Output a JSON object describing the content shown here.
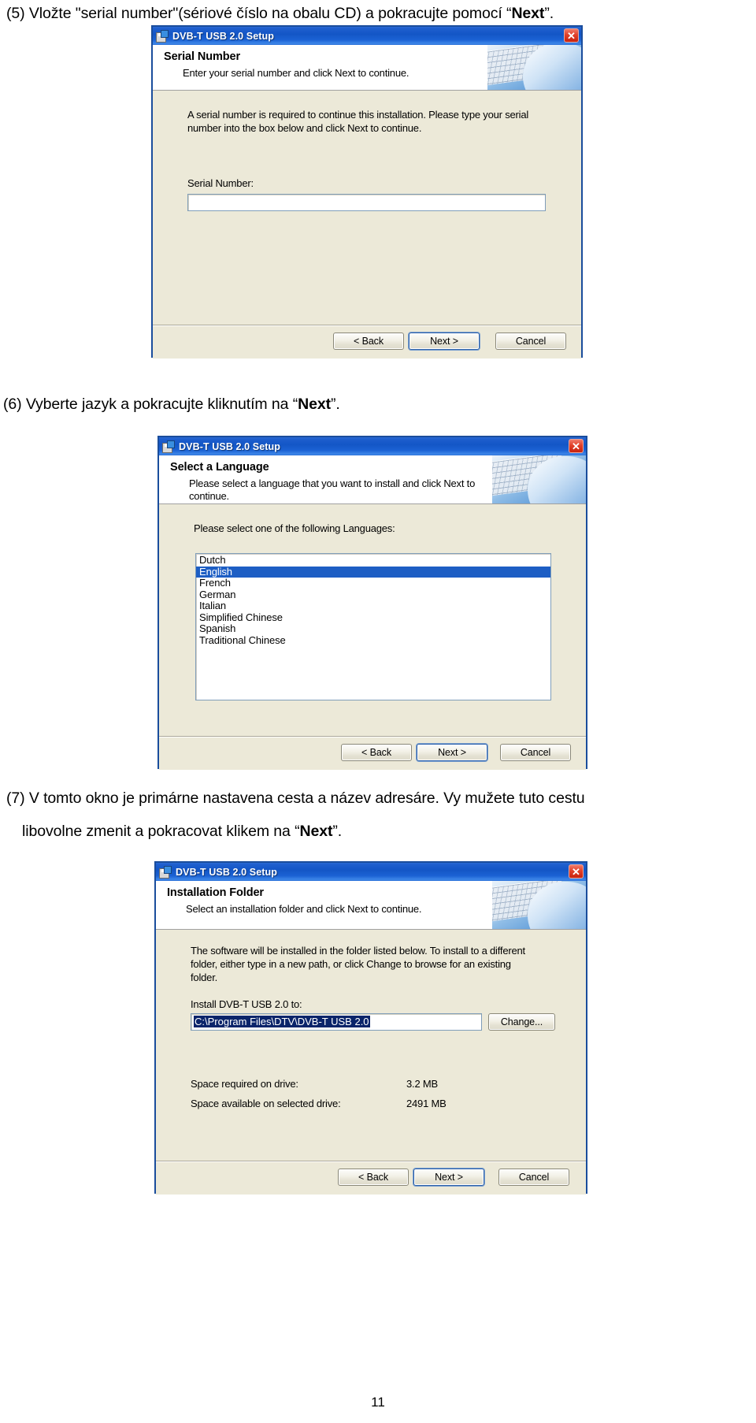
{
  "document": {
    "page_number": "11",
    "steps": [
      {
        "id": "step5",
        "text_prefix": "(5) Vložte \"serial number\"(sériové číslo na obalu CD) a pokracujte pomocí “",
        "bold": "Next",
        "text_suffix": "”."
      },
      {
        "id": "step6",
        "text_prefix": "(6) Vyberte jazyk a pokracujte kliknutím na  “",
        "bold": "Next",
        "text_suffix": "”."
      },
      {
        "id": "step7_line1",
        "text": "(7) V tomto okno  je primárne nastavena cesta a název adresáre.  Vy mužete tuto cestu"
      },
      {
        "id": "step7_line2",
        "text_prefix": "libovolne zmenit a pokracovat klikem na “",
        "bold": "Next",
        "text_suffix": "”."
      }
    ]
  },
  "dialog_serial": {
    "title": "DVB-T USB 2.0 Setup",
    "close_label": "✕",
    "header_title": "Serial Number",
    "header_subtitle": "Enter your serial number and click Next to continue.",
    "body_text": "A serial number is required to continue this installation. Please type your serial number into the box below and click Next to continue.",
    "field_label": "Serial Number:",
    "field_value": "",
    "buttons": {
      "back": "< Back",
      "next": "Next >",
      "cancel": "Cancel"
    }
  },
  "dialog_language": {
    "title": "DVB-T USB 2.0 Setup",
    "close_label": "✕",
    "header_title": "Select a Language",
    "header_subtitle": "Please select a language that you want to install and click Next to continue.",
    "body_text": "Please select one of the following Languages:",
    "languages": [
      "Dutch",
      "English",
      "French",
      "German",
      "Italian",
      "Simplified Chinese",
      "Spanish",
      "Traditional Chinese"
    ],
    "selected_language": "English",
    "buttons": {
      "back": "< Back",
      "next": "Next >",
      "cancel": "Cancel"
    }
  },
  "dialog_folder": {
    "title": "DVB-T USB 2.0 Setup",
    "close_label": "✕",
    "header_title": "Installation Folder",
    "header_subtitle": "Select an installation folder and click Next to continue.",
    "body_text": "The software will be installed in the folder listed below. To install to a different folder, either type in a new path, or click Change to browse for an existing folder.",
    "field_label": "Install DVB-T USB 2.0 to:",
    "field_value": "C:\\Program Files\\DTV\\DVB-T USB 2.0",
    "change_button": "Change...",
    "space_required_label": "Space required on drive:",
    "space_required_value": "3.2 MB",
    "space_available_label": "Space available on selected drive:",
    "space_available_value": "2491 MB",
    "buttons": {
      "back": "< Back",
      "next": "Next >",
      "cancel": "Cancel"
    }
  },
  "colors": {
    "titlebar_blue": "#1356c6",
    "dialog_border": "#1a4d9c",
    "dialog_face": "#ece9d8",
    "selection_blue": "#1d5ec4",
    "close_red": "#c7220e"
  }
}
